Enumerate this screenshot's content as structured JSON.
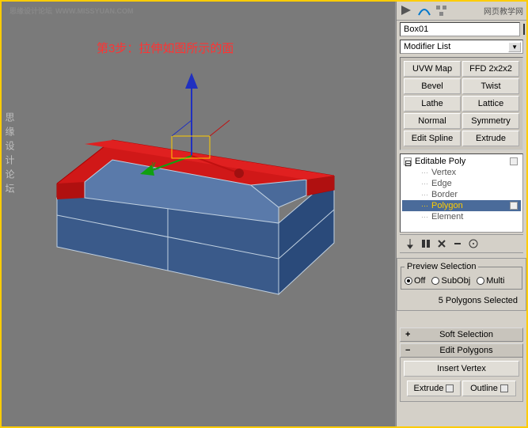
{
  "watermark_cn": "思缘设计论坛",
  "watermark_url": "WWW.MISSYUAN.COM",
  "watermark_tr": "网页教学网",
  "watermark_vert": "思缘设计论坛",
  "annotation": "第3步：拉伸如图所示的面",
  "object_name": "Box01",
  "modifier_dropdown": "Modifier List",
  "buttons": {
    "uvw": "UVW Map",
    "ffd": "FFD 2x2x2",
    "bevel": "Bevel",
    "twist": "Twist",
    "lathe": "Lathe",
    "lattice": "Lattice",
    "normal": "Normal",
    "symmetry": "Symmetry",
    "edit_spline": "Edit Spline",
    "extrude_mod": "Extrude"
  },
  "tree": {
    "root": "Editable Poly",
    "items": [
      "Vertex",
      "Edge",
      "Border",
      "Polygon",
      "Element"
    ],
    "selected": "Polygon"
  },
  "preview": {
    "legend": "Preview Selection",
    "off": "Off",
    "subobj": "SubObj",
    "multi": "Multi"
  },
  "selection_info": "5 Polygons Selected",
  "rollouts": {
    "soft": "Soft Selection",
    "edit_poly": "Edit Polygons",
    "insert_vertex": "Insert Vertex",
    "extrude": "Extrude",
    "outline": "Outline"
  }
}
